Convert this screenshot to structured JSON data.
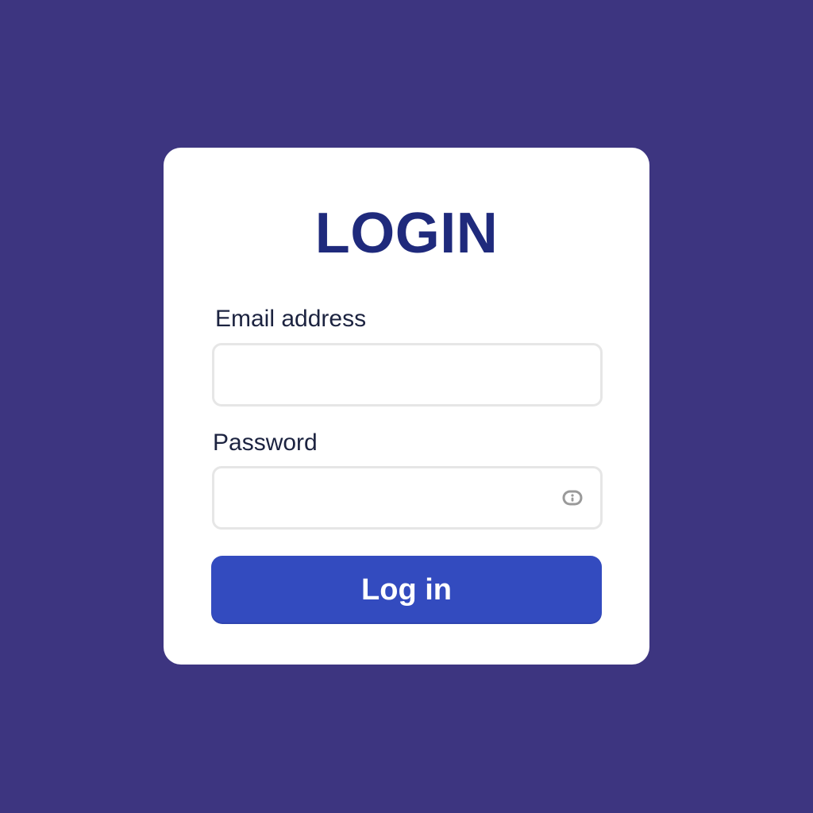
{
  "login_form": {
    "title": "LOGIN",
    "email": {
      "label": "Email address",
      "value": "",
      "placeholder": ""
    },
    "password": {
      "label": "Password",
      "value": "",
      "placeholder": "",
      "toggle_icon": "eye-icon"
    },
    "submit_label": "Log in"
  },
  "colors": {
    "background": "#3d3580",
    "card": "#ffffff",
    "title": "#1f2a7c",
    "button": "#334bbf",
    "button_text": "#ffffff",
    "field_border": "#e6e6e6"
  }
}
